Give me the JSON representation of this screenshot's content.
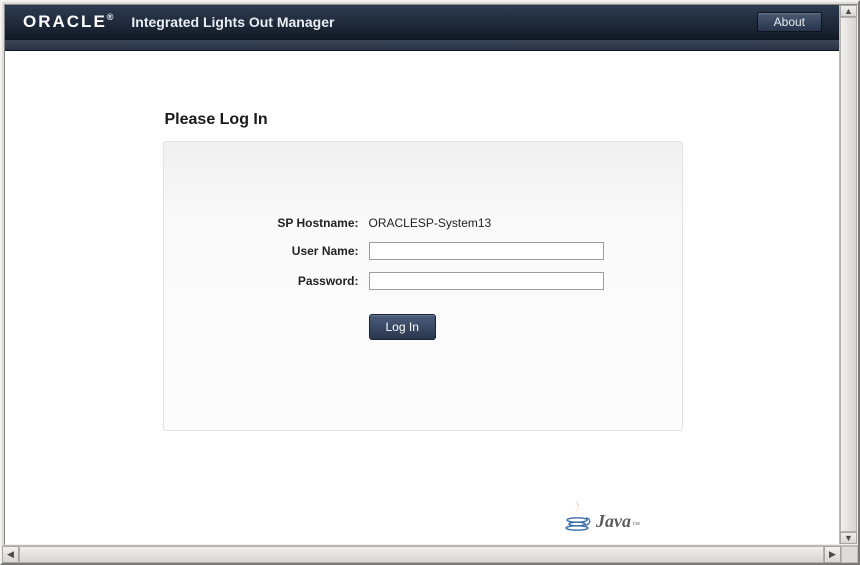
{
  "header": {
    "brand": "ORACLE",
    "brand_reg": "®",
    "product": "Integrated Lights Out Manager",
    "about_label": "About"
  },
  "login": {
    "title": "Please Log In",
    "hostname_label": "SP Hostname:",
    "hostname_value": "ORACLESP-System13",
    "username_label": "User Name:",
    "username_value": "",
    "password_label": "Password:",
    "password_value": "",
    "submit_label": "Log In"
  },
  "footer": {
    "java_text": "Java",
    "tm": "™"
  }
}
